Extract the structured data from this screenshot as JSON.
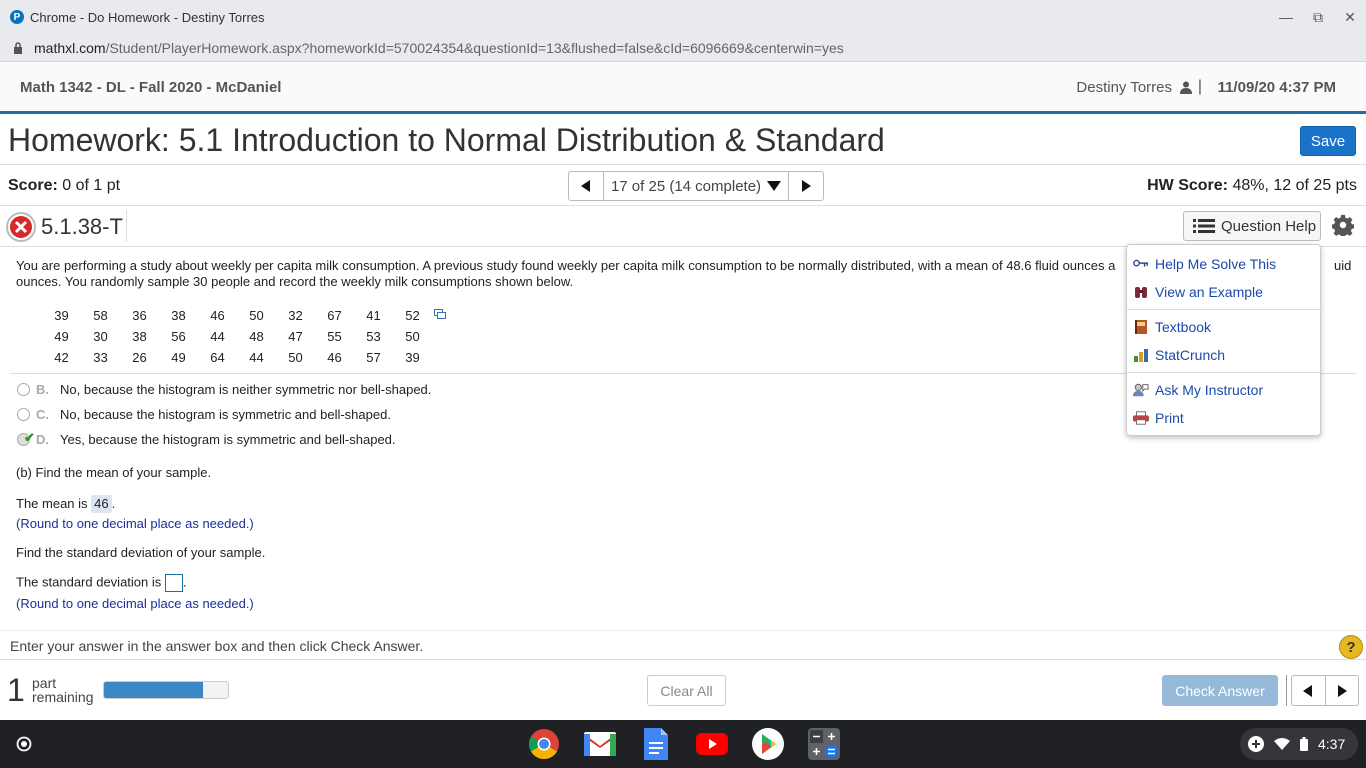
{
  "browser": {
    "window_title": "Chrome - Do Homework - Destiny Torres",
    "url_host": "mathxl.com",
    "url_path": "/Student/PlayerHomework.aspx?homeworkId=570024354&questionId=13&flushed=false&cId=6096669&centerwin=yes"
  },
  "header": {
    "course": "Math 1342 - DL - Fall 2020 - McDaniel",
    "user": "Destiny Torres",
    "separator": "|",
    "datetime": "11/09/20 4:37 PM"
  },
  "homework": {
    "title": "Homework: 5.1 Introduction to Normal Distribution & Standard",
    "save_label": "Save"
  },
  "score": {
    "label": "Score:",
    "value": "0 of 1 pt",
    "hw_label": "HW Score:",
    "hw_value": "48%, 12 of 25 pts"
  },
  "navigation": {
    "position": "17 of 25 (14 complete)"
  },
  "question": {
    "id": "5.1.38-T",
    "help_label": "Question Help",
    "prompt_line1": "You are performing a study about weekly per capita milk consumption. A previous study found weekly per capita milk consumption to be normally distributed, with a mean of 48.6 fluid ounces a",
    "prompt_tail": "uid",
    "prompt_line2": "ounces. You randomly sample 30 people and record the weekly milk consumptions shown below.",
    "data_rows": [
      [
        "39",
        "58",
        "36",
        "38",
        "46",
        "50",
        "32",
        "67",
        "41",
        "52"
      ],
      [
        "49",
        "30",
        "38",
        "56",
        "44",
        "48",
        "47",
        "55",
        "53",
        "50"
      ],
      [
        "42",
        "33",
        "26",
        "49",
        "64",
        "44",
        "50",
        "46",
        "57",
        "39"
      ]
    ],
    "options": [
      {
        "letter": "B.",
        "text": "No, because the histogram is neither symmetric nor bell-shaped."
      },
      {
        "letter": "C.",
        "text": "No, because the histogram is symmetric and bell-shaped."
      },
      {
        "letter": "D.",
        "text": "Yes, because the histogram is symmetric and bell-shaped."
      }
    ],
    "part_b": "(b) Find the mean of your sample.",
    "mean_prefix": "The mean is",
    "mean_value": "46",
    "period": ".",
    "round_hint": "(Round to one decimal place as needed.)",
    "sd_question": "Find the standard deviation of your sample.",
    "sd_prefix": "The standard deviation is",
    "sd_value": ""
  },
  "help_menu": {
    "items": [
      {
        "label": "Help Me Solve This",
        "icon": "key-icon"
      },
      {
        "label": "View an Example",
        "icon": "binoculars-icon"
      },
      {
        "label": "Textbook",
        "icon": "book-icon"
      },
      {
        "label": "StatCrunch",
        "icon": "statcrunch-icon"
      },
      {
        "label": "Ask My Instructor",
        "icon": "instructor-icon"
      },
      {
        "label": "Print",
        "icon": "printer-icon"
      }
    ]
  },
  "footer": {
    "instruction": "Enter your answer in the answer box and then click Check Answer.",
    "parts_remaining_num": "1",
    "parts_remaining_line1": "part",
    "parts_remaining_line2": "remaining",
    "progress_fraction": 0.8,
    "clear_all_label": "Clear All",
    "check_answer_label": "Check Answer",
    "help_glyph": "?"
  },
  "shelf": {
    "time": "4:37",
    "apps": [
      "chrome-icon",
      "gmail-icon",
      "docs-icon",
      "youtube-icon",
      "play-store-icon",
      "calculator-icon"
    ]
  },
  "colors": {
    "accent": "#1a6fa3",
    "save": "#1a73c8",
    "link": "#1a4aa8",
    "hint": "#1a2f9a",
    "check_disabled": "#96b9da"
  }
}
